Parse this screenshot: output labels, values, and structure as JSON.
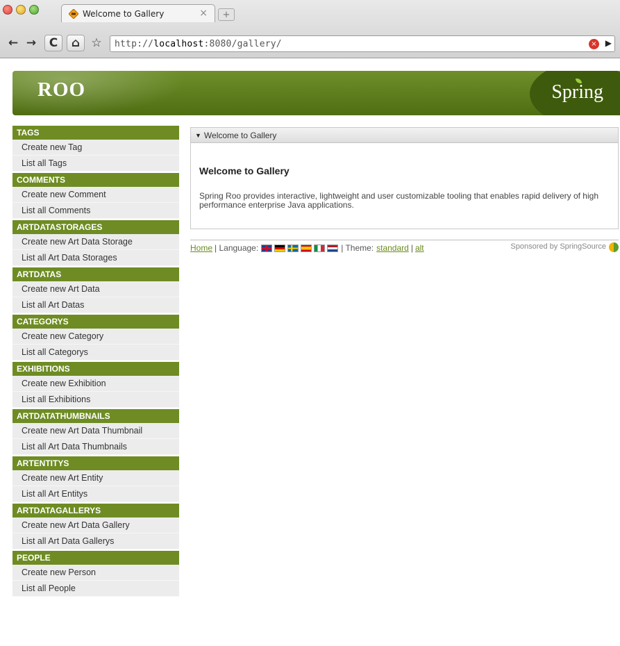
{
  "browser": {
    "tab_title": "Welcome to Gallery",
    "tab_close": "×",
    "new_tab": "+",
    "url_prefix": "http://",
    "url_host": "localhost",
    "url_rest": ":8080/gallery/",
    "nav": {
      "back": "←",
      "forward": "→",
      "reload": "C",
      "home": "⌂",
      "bookmark": "☆"
    },
    "stop": "×",
    "go": "▶"
  },
  "header": {
    "roo_logo": "ROO",
    "spring_logo": "Spring"
  },
  "sidebar": {
    "sections": [
      {
        "title": "TAGS",
        "items": [
          "Create new Tag",
          "List all Tags"
        ]
      },
      {
        "title": "COMMENTS",
        "items": [
          "Create new Comment",
          "List all Comments"
        ]
      },
      {
        "title": "ARTDATASTORAGES",
        "items": [
          "Create new Art Data Storage",
          "List all Art Data Storages"
        ]
      },
      {
        "title": "ARTDATAS",
        "items": [
          "Create new Art Data",
          "List all Art Datas"
        ]
      },
      {
        "title": "CATEGORYS",
        "items": [
          "Create new Category",
          "List all Categorys"
        ]
      },
      {
        "title": "EXHIBITIONS",
        "items": [
          "Create new Exhibition",
          "List all Exhibitions"
        ]
      },
      {
        "title": "ARTDATATHUMBNAILS",
        "items": [
          "Create new Art Data Thumbnail",
          "List all Art Data Thumbnails"
        ]
      },
      {
        "title": "ARTENTITYS",
        "items": [
          "Create new Art Entity",
          "List all Art Entitys"
        ]
      },
      {
        "title": "ARTDATAGALLERYS",
        "items": [
          "Create new Art Data Gallery",
          "List all Art Data Gallerys"
        ]
      },
      {
        "title": "PEOPLE",
        "items": [
          "Create new Person",
          "List all People"
        ]
      }
    ]
  },
  "panel": {
    "header": "Welcome to Gallery",
    "title": "Welcome to Gallery",
    "text": "Spring Roo provides interactive, lightweight and user customizable tooling that enables rapid delivery of high performance enterprise Java applications."
  },
  "footer": {
    "home": "Home",
    "language_label": "| Language:",
    "theme_label": "| Theme:",
    "theme_standard": "standard",
    "theme_sep": "|",
    "theme_alt": "alt",
    "sponsor": "Sponsored by SpringSource"
  },
  "colors": {
    "brand_green": "#6e8c23",
    "link_green": "#6a8a1e"
  }
}
